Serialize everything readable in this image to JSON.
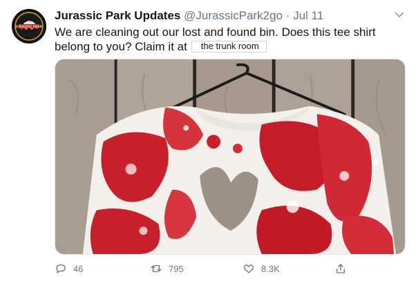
{
  "tweet": {
    "display_name": "Jurassic Park Updates",
    "handle": "@JurassicPark2go",
    "separator": "·",
    "date": "Jul 11",
    "text": "We are cleaning out our lost and found bin. Does this tee shirt belong to you? Claim it at",
    "link_text": "the trunk room",
    "avatar_logo_text": "JURASSIC PARK"
  },
  "actions": {
    "replies": "46",
    "retweets": "795",
    "likes": "8.3K"
  },
  "icons": {
    "reply": "reply-icon",
    "retweet": "retweet-icon",
    "like": "heart-icon",
    "share": "share-icon",
    "more": "chevron-down-icon"
  },
  "colors": {
    "text": "#14171a",
    "secondary": "#657786",
    "blood": "#c8202a",
    "fence": "#9c8f83"
  }
}
